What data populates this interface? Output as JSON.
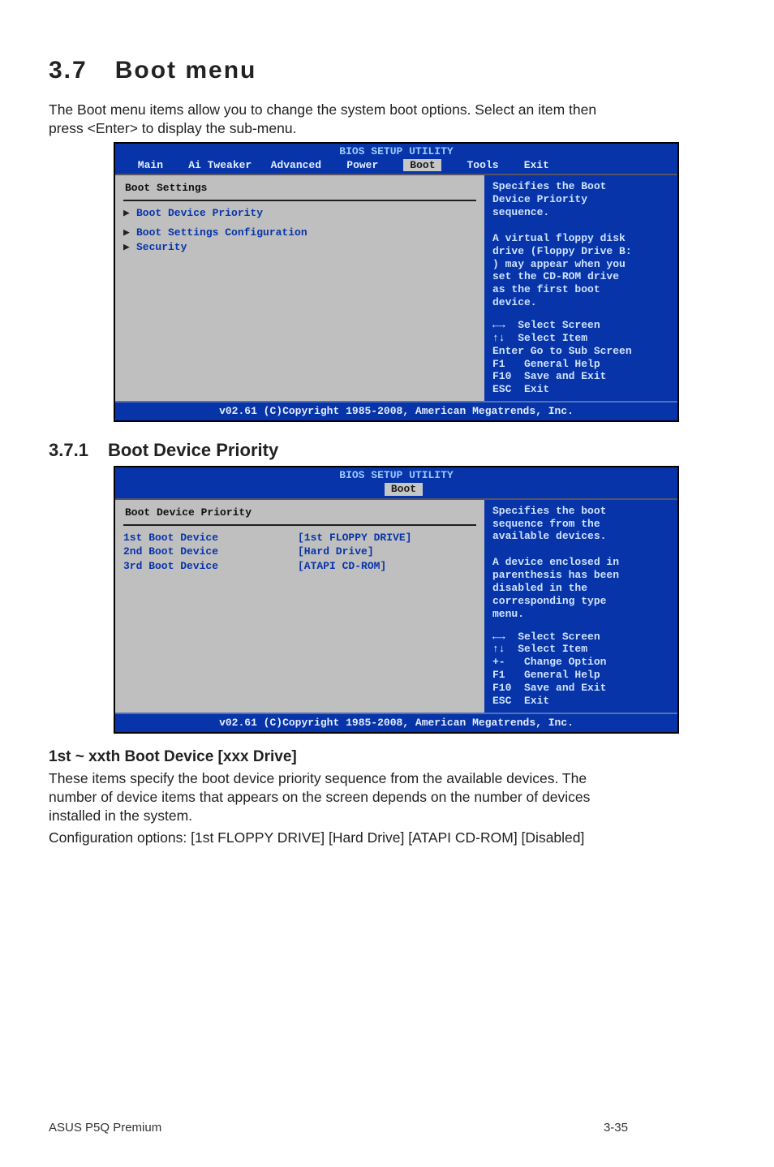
{
  "section": {
    "number": "3.7",
    "title": "Boot menu"
  },
  "intro_text": "The Boot menu items allow you to change the system boot options. Select an item then press <Enter> to display the sub-menu.",
  "bios1": {
    "header": "BIOS SETUP UTILITY",
    "tabs": [
      "Main",
      "Ai Tweaker",
      "Advanced",
      "Power",
      "Boot",
      "Tools",
      "Exit"
    ],
    "active_tab": "Boot",
    "panel_title": "Boot Settings",
    "items": [
      {
        "label": "Boot Device Priority",
        "arrow": true
      },
      {
        "label": "Boot Settings Configuration",
        "arrow": true
      },
      {
        "label": "Security",
        "arrow": true
      }
    ],
    "help": "Specifies the Boot\nDevice Priority\nsequence.\n\nA virtual floppy disk\ndrive (Floppy Drive B:\n) may appear when you\nset the CD-ROM drive\nas the first boot\ndevice.",
    "keys": [
      {
        "glyph": "←→",
        "text": "  Select Screen"
      },
      {
        "glyph": "↑↓",
        "text": "  Select Item"
      },
      {
        "glyph": "Enter",
        "text": "Go to Sub Screen",
        "prefix": "Enter "
      },
      {
        "glyph": "F1",
        "text": "  General Help"
      },
      {
        "glyph": "F10",
        "text": " Save and Exit"
      },
      {
        "glyph": "ESC",
        "text": " Exit"
      }
    ],
    "footer": "v02.61 (C)Copyright 1985-2008, American Megatrends, Inc."
  },
  "subsection": {
    "number": "3.7.1",
    "title": "Boot Device Priority"
  },
  "bios2": {
    "header": "BIOS SETUP UTILITY",
    "tabs_offset": "                                        ",
    "active_tab": "Boot",
    "panel_title": "Boot Device Priority",
    "rows": [
      {
        "label": "1st Boot Device",
        "value": "[1st FLOPPY DRIVE]"
      },
      {
        "label": "2nd Boot Device",
        "value": "[Hard Drive]"
      },
      {
        "label": "3rd Boot Device",
        "value": "[ATAPI CD-ROM]"
      }
    ],
    "help": "Specifies the boot\nsequence from the\navailable devices.\n\nA device enclosed in\nparenthesis has been\ndisabled in the\ncorresponding type\nmenu.",
    "keys": [
      {
        "glyph": "←→",
        "text": "  Select Screen"
      },
      {
        "glyph": "↑↓",
        "text": "  Select Item"
      },
      {
        "glyph": "+-",
        "text": "  Change Option"
      },
      {
        "glyph": "F1",
        "text": "  General Help"
      },
      {
        "glyph": "F10",
        "text": " Save and Exit"
      },
      {
        "glyph": "ESC",
        "text": " Exit"
      }
    ],
    "footer": "v02.61 (C)Copyright 1985-2008, American Megatrends, Inc."
  },
  "sub_heading": "1st ~ xxth Boot Device [xxx Drive]",
  "body_p1": "These items specify the boot device priority sequence from the available devices. The number of device items that appears on the screen depends on the number of devices installed in the system.",
  "body_p2": "Configuration options: [1st FLOPPY DRIVE] [Hard Drive] [ATAPI CD-ROM] [Disabled]",
  "footer_left": "ASUS P5Q Premium",
  "footer_right": "3-35"
}
